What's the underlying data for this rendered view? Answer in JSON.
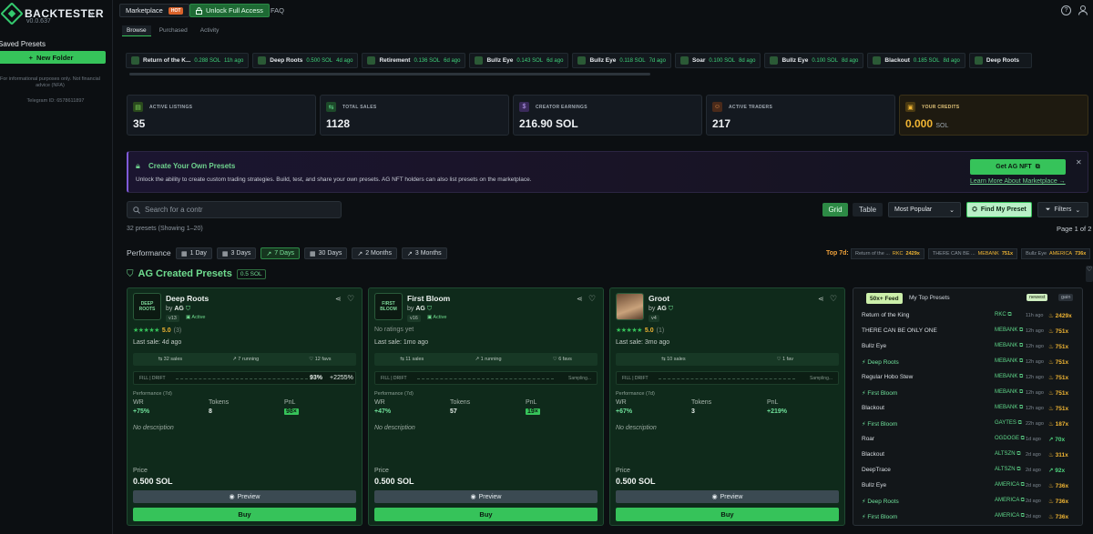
{
  "sidebar": {
    "brand": "BACKTESTER",
    "version": "v0.0.637",
    "saved_presets": "Saved Presets",
    "new_folder": "New Folder",
    "disclaimer": "For informational purposes only. Not financial advice (NFA)",
    "telegram": "Telegram ID: 6578611897"
  },
  "topnav": {
    "marketplace": "Marketplace",
    "hot": "HOT",
    "unlock": "Unlock Full Access",
    "faq": "FAQ",
    "help": "?"
  },
  "subtabs": [
    "Browse",
    "Purchased",
    "Activity"
  ],
  "ticker": [
    {
      "name": "Return of the K...",
      "price": "0.288 SOL",
      "ago": "11h ago"
    },
    {
      "name": "Deep Roots",
      "price": "0.500 SOL",
      "ago": "4d ago"
    },
    {
      "name": "Retirement",
      "price": "0.136 SOL",
      "ago": "6d ago"
    },
    {
      "name": "Bullz Eye",
      "price": "0.143 SOL",
      "ago": "6d ago"
    },
    {
      "name": "Bullz Eye",
      "price": "0.118 SOL",
      "ago": "7d ago"
    },
    {
      "name": "Soar",
      "price": "0.100 SOL",
      "ago": "8d ago"
    },
    {
      "name": "Bullz Eye",
      "price": "0.100 SOL",
      "ago": "8d ago"
    },
    {
      "name": "Blackout",
      "price": "0.185 SOL",
      "ago": "8d ago"
    },
    {
      "name": "Deep Roots",
      "price": "",
      "ago": ""
    }
  ],
  "stats": [
    {
      "label": "ACTIVE LISTINGS",
      "value": "35",
      "icon": "list-icon"
    },
    {
      "label": "TOTAL SALES",
      "value": "1128",
      "icon": "sales-icon"
    },
    {
      "label": "CREATOR EARNINGS",
      "value": "216.90 SOL",
      "icon": "dollar-icon"
    },
    {
      "label": "ACTIVE TRADERS",
      "value": "217",
      "icon": "users-icon"
    },
    {
      "label": "YOUR CREDITS",
      "value": "0.000",
      "unit": "SOL",
      "icon": "wallet-icon"
    }
  ],
  "banner": {
    "title": "Create Your Own Presets",
    "subtitle": "Unlock the ability to create custom trading strategies. Build, test, and share your own presets. AG NFT holders can also list presets on the marketplace.",
    "get_nft": "Get AG NFT",
    "learn_more": "Learn More About Marketplace →"
  },
  "search": {
    "placeholder": "Search for a contr"
  },
  "view": {
    "grid": "Grid",
    "table": "Table",
    "sort": "Most Popular",
    "find": "Find My Preset",
    "filters": "Filters"
  },
  "count_text": "32 presets  (Showing 1–20)",
  "page_text": "Page 1 of 2",
  "performance": {
    "label": "Performance",
    "tabs": [
      "1 Day",
      "3 Days",
      "7 Days",
      "30 Days",
      "2 Months",
      "3 Months"
    ],
    "active": "7 Days",
    "top_label": "Top 7d:",
    "top": [
      {
        "name": "Return of the ...",
        "user": "RKC",
        "mult": "2429x"
      },
      {
        "name": "THERE CAN BE ...",
        "user": "MEBANK",
        "mult": "751x"
      },
      {
        "name": "Bullz Eye",
        "user": "AMERICA",
        "mult": "736x"
      }
    ]
  },
  "ag_section": {
    "title": "AG Created Presets",
    "price_chip": "0.5 SOL"
  },
  "cards": [
    {
      "name": "Deep Roots",
      "by": "AG",
      "version": "v13",
      "status": "Active",
      "rating": "5.0",
      "rating_count": "(3)",
      "no_ratings": "",
      "last_sale": "Last sale: 4d ago",
      "sales": "32 sales",
      "running": "7 running",
      "favs": "12 favs",
      "fill_label": "FILL | DRIFT",
      "fill_pct": "93%",
      "fill_pct2": "+2255%",
      "sampling": "",
      "perf_label": "Performance (7d)",
      "wr": "+75%",
      "tokens": "8",
      "pnl": "98×",
      "desc": "No description",
      "price_label": "Price",
      "price": "0.500 SOL",
      "avatar_text": "DEEP ROOTS"
    },
    {
      "name": "First Bloom",
      "by": "AG",
      "version": "v16",
      "status": "Active",
      "rating": "",
      "rating_count": "",
      "no_ratings": "No ratings yet",
      "last_sale": "Last sale: 1mo ago",
      "sales": "11 sales",
      "running": "1 running",
      "favs": "6 favs",
      "fill_label": "FILL | DRIFT",
      "fill_pct": "",
      "fill_pct2": "",
      "sampling": "Sampling...",
      "perf_label": "Performance (7d)",
      "wr": "+47%",
      "tokens": "57",
      "pnl": "19×",
      "desc": "No description",
      "price_label": "Price",
      "price": "0.500 SOL",
      "avatar_text": "FIRST BLOOM"
    },
    {
      "name": "Groot",
      "by": "AG",
      "version": "v4",
      "status": "",
      "rating": "5.0",
      "rating_count": "(1)",
      "no_ratings": "",
      "last_sale": "Last sale: 3mo ago",
      "sales": "10 sales",
      "running": "",
      "favs": "1 fav",
      "fill_label": "FILL | DRIFT",
      "fill_pct": "",
      "fill_pct2": "",
      "sampling": "Sampling...",
      "perf_label": "Performance (7d)",
      "wr": "+67%",
      "tokens": "3",
      "pnl": "+219%",
      "desc": "No description",
      "price_label": "Price",
      "price": "0.500 SOL",
      "avatar_text": ""
    }
  ],
  "card_labels": {
    "wr": "WR",
    "tokens": "Tokens",
    "pnl": "PnL",
    "preview": "Preview",
    "buy": "Buy",
    "by": "by"
  },
  "feed": {
    "tab1": "50x+ Feed",
    "tab2": "My Top Presets",
    "newest": "newest",
    "gain": "gain",
    "rows": [
      {
        "name": "Return of the King",
        "user": "RKC",
        "time": "11h ago",
        "mult": "2429x",
        "green": false
      },
      {
        "name": "THERE CAN BE ONLY ONE",
        "user": "MEBANK",
        "time": "12h ago",
        "mult": "751x",
        "green": false
      },
      {
        "name": "Bullz Eye",
        "user": "MEBANK",
        "time": "12h ago",
        "mult": "751x",
        "green": false
      },
      {
        "name": "Deep Roots",
        "user": "MEBANK",
        "time": "12h ago",
        "mult": "751x",
        "green": true
      },
      {
        "name": "Regular Hobo Stew",
        "user": "MEBANK",
        "time": "12h ago",
        "mult": "751x",
        "green": false
      },
      {
        "name": "First Bloom",
        "user": "MEBANK",
        "time": "12h ago",
        "mult": "751x",
        "green": true
      },
      {
        "name": "Blackout",
        "user": "MEBANK",
        "time": "12h ago",
        "mult": "751x",
        "green": false
      },
      {
        "name": "First Bloom",
        "user": "GAYTES",
        "time": "22h ago",
        "mult": "187x",
        "green": true
      },
      {
        "name": "Roar",
        "user": "OGDOGE",
        "time": "1d ago",
        "mult": "70x",
        "green": false,
        "multgreen": true
      },
      {
        "name": "Blackout",
        "user": "ALTSZN",
        "time": "2d ago",
        "mult": "311x",
        "green": false
      },
      {
        "name": "DeepTrace",
        "user": "ALTSZN",
        "time": "2d ago",
        "mult": "92x",
        "green": false,
        "multgreen": true
      },
      {
        "name": "Bullz Eye",
        "user": "AMERICA",
        "time": "2d ago",
        "mult": "736x",
        "green": false
      },
      {
        "name": "Deep Roots",
        "user": "AMERICA",
        "time": "2d ago",
        "mult": "736x",
        "green": true
      },
      {
        "name": "First Bloom",
        "user": "AMERICA",
        "time": "2d ago",
        "mult": "736x",
        "green": true
      }
    ]
  },
  "colors": {
    "accent": "#36c35a",
    "gold": "#f0b533",
    "banner_purple": "#7f5ad8"
  }
}
